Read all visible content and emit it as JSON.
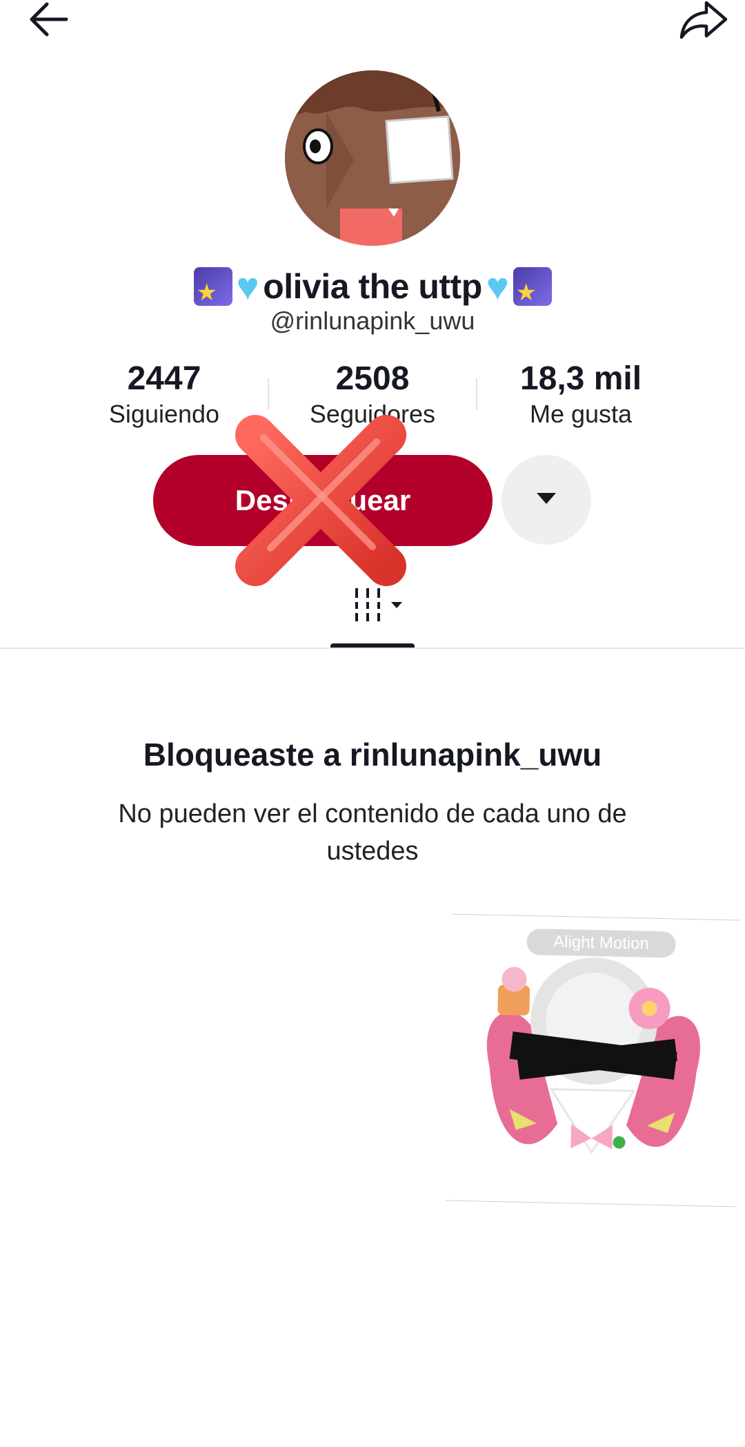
{
  "header": {
    "back_icon": "back-arrow-icon",
    "share_icon": "share-arrow-icon"
  },
  "profile": {
    "display_name_prefix_emojis": [
      "comet-emoji",
      "light-blue-heart-emoji"
    ],
    "display_name": "olivia the uttp",
    "display_name_suffix_emojis": [
      "light-blue-heart-emoji",
      "comet-emoji"
    ],
    "username": "@rinlunapink_uwu",
    "avatar_icon": "avatar-image"
  },
  "stats": [
    {
      "value": "2447",
      "label": "Siguiendo"
    },
    {
      "value": "2508",
      "label": "Seguidores"
    },
    {
      "value": "18,3 mil",
      "label": "Me gusta"
    }
  ],
  "actions": {
    "unblock_label": "Desbloquear",
    "more_icon": "caret-down-icon"
  },
  "tabs": {
    "active_icon": "grid-icon"
  },
  "blocked": {
    "title": "Bloqueaste a rinlunapink_uwu",
    "description": "No pueden ver el contenido de cada uno de ustedes"
  },
  "sticker": {
    "watermark": "Alight Motion"
  },
  "colors": {
    "unblock_button": "#b3002b",
    "more_button": "#efefef",
    "overlay_x": "#e8433a"
  }
}
